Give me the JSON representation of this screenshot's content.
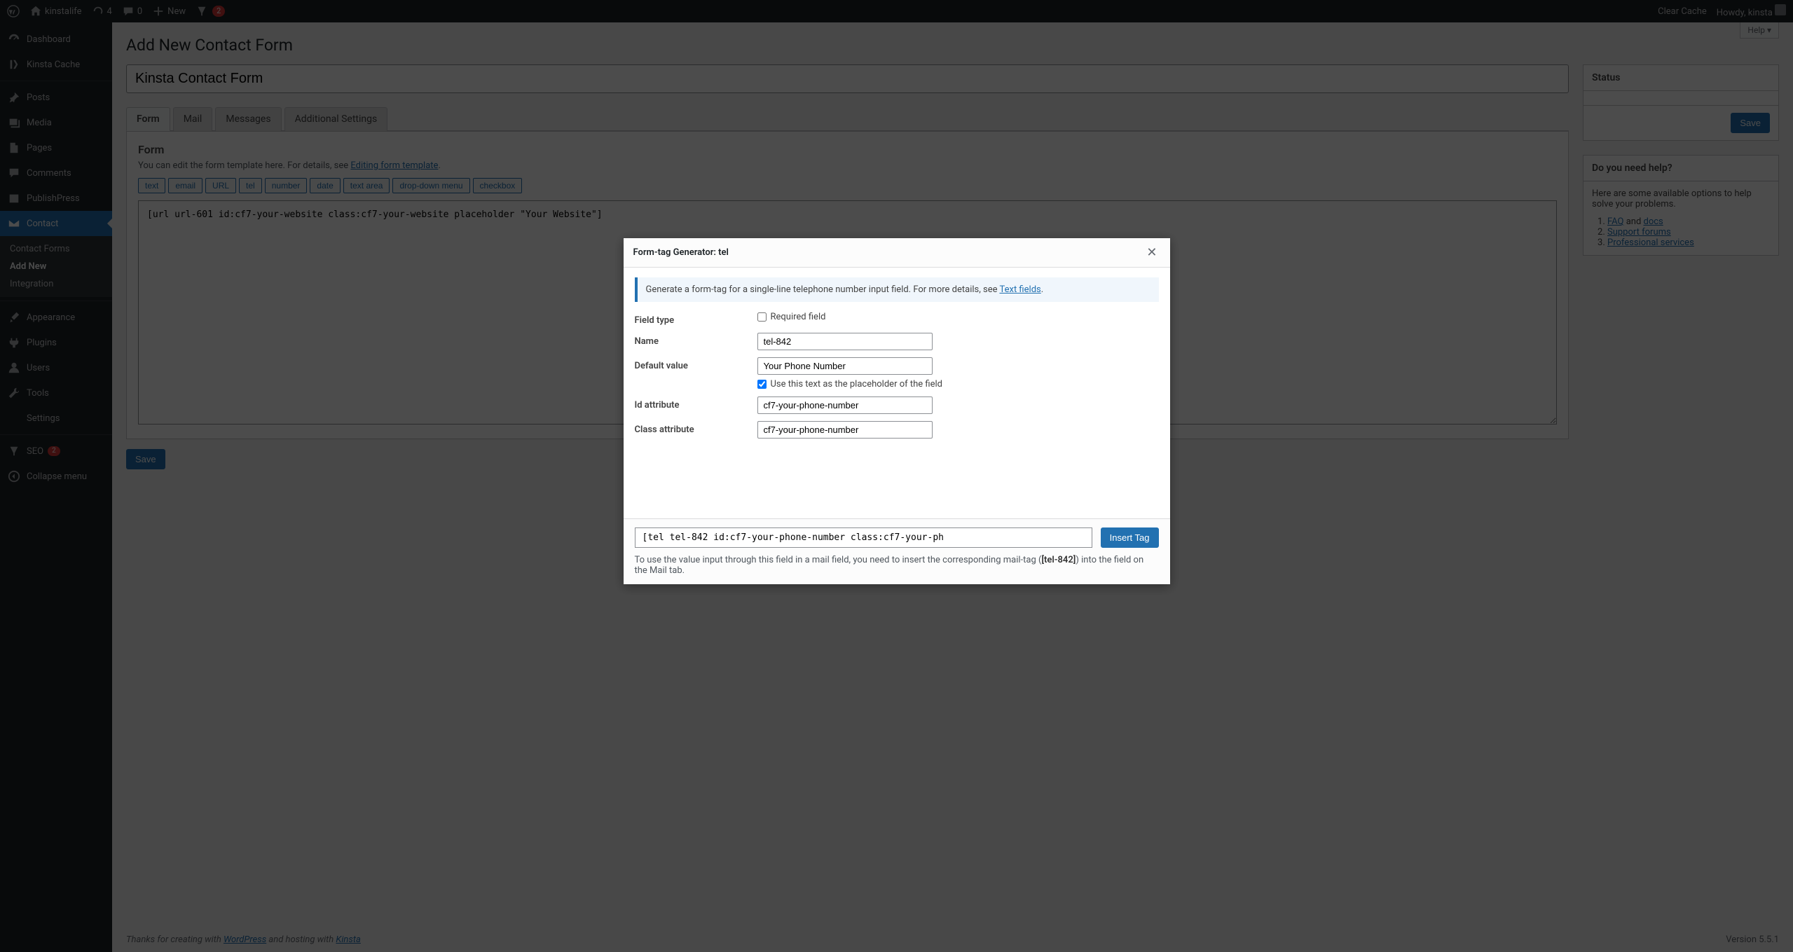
{
  "adminbar": {
    "site_name": "kinstalife",
    "updates_count": "4",
    "comments_count": "0",
    "new_label": "New",
    "yoast_badge": "2",
    "clear_cache": "Clear Cache",
    "howdy_prefix": "Howdy, ",
    "username": "kinsta"
  },
  "sidebar": {
    "items": [
      {
        "label": "Dashboard",
        "icon": "dashboard"
      },
      {
        "label": "Kinsta Cache",
        "icon": "kinsta"
      },
      {
        "label": "Posts",
        "icon": "pin"
      },
      {
        "label": "Media",
        "icon": "media"
      },
      {
        "label": "Pages",
        "icon": "page"
      },
      {
        "label": "Comments",
        "icon": "comment"
      },
      {
        "label": "PublishPress",
        "icon": "calendar"
      },
      {
        "label": "Contact",
        "icon": "mail",
        "current": true
      },
      {
        "label": "Appearance",
        "icon": "brush"
      },
      {
        "label": "Plugins",
        "icon": "plugin"
      },
      {
        "label": "Users",
        "icon": "user"
      },
      {
        "label": "Tools",
        "icon": "wrench"
      },
      {
        "label": "Settings",
        "icon": "settings"
      },
      {
        "label": "SEO",
        "icon": "seo",
        "badge": "2"
      },
      {
        "label": "Collapse menu",
        "icon": "collapse"
      }
    ],
    "submenu": [
      {
        "label": "Contact Forms"
      },
      {
        "label": "Add New",
        "current": true
      },
      {
        "label": "Integration"
      }
    ]
  },
  "page": {
    "title": "Add New Contact Form",
    "help": "Help",
    "form_title": "Kinsta Contact Form",
    "tabs": [
      "Form",
      "Mail",
      "Messages",
      "Additional Settings"
    ],
    "active_tab": 0,
    "panel_heading": "Form",
    "panel_desc_prefix": "You can edit the form template here. For details, see ",
    "panel_desc_link": "Editing form template",
    "tag_buttons": [
      "text",
      "email",
      "URL",
      "tel",
      "number",
      "date",
      "text area",
      "drop-down menu",
      "checkbox"
    ],
    "editor_value": "[url url-601 id:cf7-your-website class:cf7-your-website placeholder \"Your Website\"]",
    "save_label": "Save"
  },
  "side": {
    "status_title": "Status",
    "save_label": "Save",
    "help_title": "Do you need help?",
    "help_intro": "Here are some available options to help solve your problems.",
    "help_links": [
      {
        "prefix": "",
        "link1": "FAQ",
        "mid": " and ",
        "link2": "docs"
      },
      {
        "link1": "Support forums"
      },
      {
        "link1": "Professional services"
      }
    ]
  },
  "footer": {
    "prefix": "Thanks for creating with ",
    "wp": "WordPress",
    "mid": " and hosting with ",
    "kinsta": "Kinsta",
    "version": "Version 5.5.1"
  },
  "dialog": {
    "title": "Form-tag Generator: tel",
    "info_prefix": "Generate a form-tag for a single-line telephone number input field. For more details, see ",
    "info_link": "Text fields",
    "field_type_label": "Field type",
    "required_label": "Required field",
    "required_checked": false,
    "name_label": "Name",
    "name_value": "tel-842",
    "default_label": "Default value",
    "default_value": "Your Phone Number",
    "placeholder_label": "Use this text as the placeholder of the field",
    "placeholder_checked": true,
    "id_label": "Id attribute",
    "id_value": "cf7-your-phone-number",
    "class_label": "Class attribute",
    "class_value": "cf7-your-phone-number",
    "tag_output": "[tel tel-842 id:cf7-your-phone-number class:cf7-your-ph",
    "insert_label": "Insert Tag",
    "note_prefix": "To use the value input through this field in a mail field, you need to insert the corresponding mail-tag (",
    "note_tag": "[tel-842]",
    "note_suffix": ") into the field on the Mail tab."
  }
}
